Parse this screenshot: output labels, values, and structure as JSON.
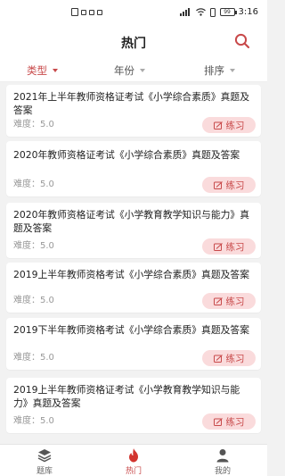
{
  "status_bar": {
    "time": "3:16",
    "battery_level": "99"
  },
  "header": {
    "title": "热门"
  },
  "filters": [
    {
      "label": "类型",
      "active": true
    },
    {
      "label": "年份",
      "active": false
    },
    {
      "label": "排序",
      "active": false
    }
  ],
  "items": [
    {
      "title": "2021年上半年教师资格证考试《小学综合素质》真题及答案",
      "difficulty": "难度：5.0",
      "action": "练习"
    },
    {
      "title": "2020年教师资格证考试《小学综合素质》真题及答案",
      "difficulty": "难度：5.0",
      "action": "练习"
    },
    {
      "title": "2020年教师资格证考试《小学教育教学知识与能力》真题及答案",
      "difficulty": "难度：5.0",
      "action": "练习"
    },
    {
      "title": "2019上半年教师资格考试《小学综合素质》真题及答案",
      "difficulty": "难度：5.0",
      "action": "练习"
    },
    {
      "title": "2019下半年教师资格考试《小学综合素质》真题及答案",
      "difficulty": "难度：5.0",
      "action": "练习"
    },
    {
      "title": "2019上半年教师资格证考试《小学教育教学知识与能力》真题及答案",
      "difficulty": "难度：5.0",
      "action": "练习"
    }
  ],
  "tabs": [
    {
      "label": "题库",
      "icon": "layers-icon"
    },
    {
      "label": "热门",
      "icon": "flame-icon",
      "active": true
    },
    {
      "label": "我的",
      "icon": "user-icon"
    }
  ],
  "colors": {
    "accent": "#c8494a",
    "accent_light": "#fadbdc",
    "background": "#f2f2f2"
  }
}
